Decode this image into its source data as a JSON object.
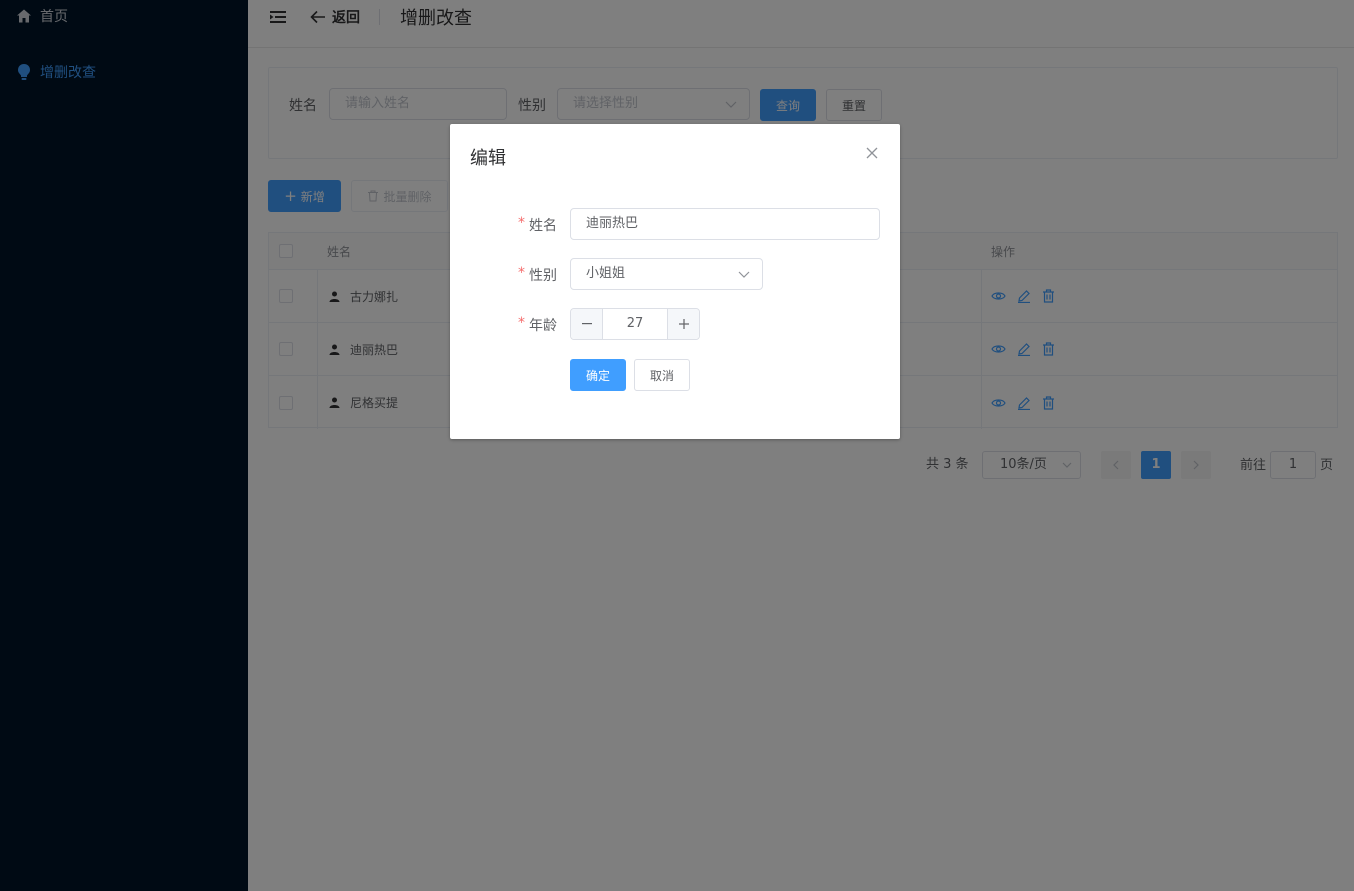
{
  "sidebar": {
    "items": [
      {
        "label": "首页",
        "icon": "home-icon"
      },
      {
        "label": "增删改查",
        "icon": "bulb-icon",
        "active": true
      }
    ],
    "active_color": "#409eff"
  },
  "header": {
    "back_label": "返回",
    "title": "增删改查"
  },
  "search": {
    "name_label": "姓名",
    "name_placeholder": "请输入姓名",
    "gender_label": "性别",
    "gender_placeholder": "请选择性别",
    "query_label": "查询",
    "reset_label": "重置"
  },
  "toolbar": {
    "add_label": "新增",
    "batch_delete_label": "批量删除"
  },
  "table": {
    "headers": {
      "name": "姓名",
      "actions": "操作"
    },
    "rows": [
      {
        "name": "古力娜扎"
      },
      {
        "name": "迪丽热巴"
      },
      {
        "name": "尼格买提"
      }
    ]
  },
  "pagination": {
    "total_text": "共 3 条",
    "page_size": "10条/页",
    "current_page": "1",
    "goto_prefix": "前往",
    "goto_value": "1",
    "goto_suffix": "页"
  },
  "dialog": {
    "title": "编辑",
    "name_label": "姓名",
    "name_value": "迪丽热巴",
    "gender_label": "性别",
    "gender_value": "小姐姐",
    "age_label": "年龄",
    "age_value": "27",
    "confirm_label": "确定",
    "cancel_label": "取消",
    "required_mark": "*"
  },
  "colors": {
    "primary": "#409eff",
    "sidebar_bg": "#001529",
    "danger": "#f56c6c"
  }
}
